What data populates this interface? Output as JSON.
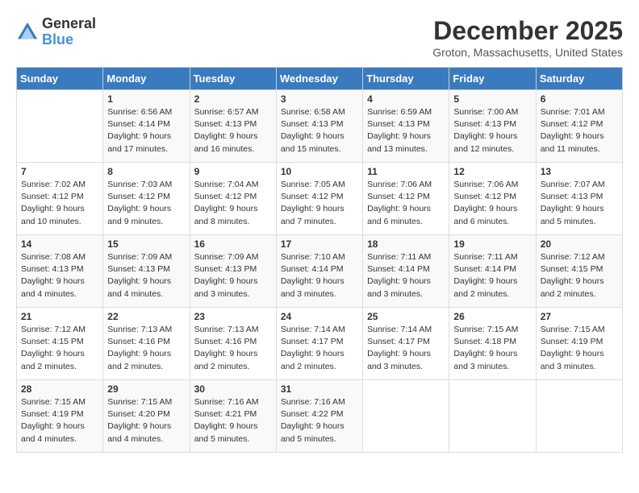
{
  "logo": {
    "text_general": "General",
    "text_blue": "Blue"
  },
  "title": "December 2025",
  "location": "Groton, Massachusetts, United States",
  "weekdays": [
    "Sunday",
    "Monday",
    "Tuesday",
    "Wednesday",
    "Thursday",
    "Friday",
    "Saturday"
  ],
  "weeks": [
    [
      {
        "day": "",
        "sunrise": "",
        "sunset": "",
        "daylight": ""
      },
      {
        "day": "1",
        "sunrise": "Sunrise: 6:56 AM",
        "sunset": "Sunset: 4:14 PM",
        "daylight": "Daylight: 9 hours and 17 minutes."
      },
      {
        "day": "2",
        "sunrise": "Sunrise: 6:57 AM",
        "sunset": "Sunset: 4:13 PM",
        "daylight": "Daylight: 9 hours and 16 minutes."
      },
      {
        "day": "3",
        "sunrise": "Sunrise: 6:58 AM",
        "sunset": "Sunset: 4:13 PM",
        "daylight": "Daylight: 9 hours and 15 minutes."
      },
      {
        "day": "4",
        "sunrise": "Sunrise: 6:59 AM",
        "sunset": "Sunset: 4:13 PM",
        "daylight": "Daylight: 9 hours and 13 minutes."
      },
      {
        "day": "5",
        "sunrise": "Sunrise: 7:00 AM",
        "sunset": "Sunset: 4:13 PM",
        "daylight": "Daylight: 9 hours and 12 minutes."
      },
      {
        "day": "6",
        "sunrise": "Sunrise: 7:01 AM",
        "sunset": "Sunset: 4:12 PM",
        "daylight": "Daylight: 9 hours and 11 minutes."
      }
    ],
    [
      {
        "day": "7",
        "sunrise": "Sunrise: 7:02 AM",
        "sunset": "Sunset: 4:12 PM",
        "daylight": "Daylight: 9 hours and 10 minutes."
      },
      {
        "day": "8",
        "sunrise": "Sunrise: 7:03 AM",
        "sunset": "Sunset: 4:12 PM",
        "daylight": "Daylight: 9 hours and 9 minutes."
      },
      {
        "day": "9",
        "sunrise": "Sunrise: 7:04 AM",
        "sunset": "Sunset: 4:12 PM",
        "daylight": "Daylight: 9 hours and 8 minutes."
      },
      {
        "day": "10",
        "sunrise": "Sunrise: 7:05 AM",
        "sunset": "Sunset: 4:12 PM",
        "daylight": "Daylight: 9 hours and 7 minutes."
      },
      {
        "day": "11",
        "sunrise": "Sunrise: 7:06 AM",
        "sunset": "Sunset: 4:12 PM",
        "daylight": "Daylight: 9 hours and 6 minutes."
      },
      {
        "day": "12",
        "sunrise": "Sunrise: 7:06 AM",
        "sunset": "Sunset: 4:12 PM",
        "daylight": "Daylight: 9 hours and 6 minutes."
      },
      {
        "day": "13",
        "sunrise": "Sunrise: 7:07 AM",
        "sunset": "Sunset: 4:13 PM",
        "daylight": "Daylight: 9 hours and 5 minutes."
      }
    ],
    [
      {
        "day": "14",
        "sunrise": "Sunrise: 7:08 AM",
        "sunset": "Sunset: 4:13 PM",
        "daylight": "Daylight: 9 hours and 4 minutes."
      },
      {
        "day": "15",
        "sunrise": "Sunrise: 7:09 AM",
        "sunset": "Sunset: 4:13 PM",
        "daylight": "Daylight: 9 hours and 4 minutes."
      },
      {
        "day": "16",
        "sunrise": "Sunrise: 7:09 AM",
        "sunset": "Sunset: 4:13 PM",
        "daylight": "Daylight: 9 hours and 3 minutes."
      },
      {
        "day": "17",
        "sunrise": "Sunrise: 7:10 AM",
        "sunset": "Sunset: 4:14 PM",
        "daylight": "Daylight: 9 hours and 3 minutes."
      },
      {
        "day": "18",
        "sunrise": "Sunrise: 7:11 AM",
        "sunset": "Sunset: 4:14 PM",
        "daylight": "Daylight: 9 hours and 3 minutes."
      },
      {
        "day": "19",
        "sunrise": "Sunrise: 7:11 AM",
        "sunset": "Sunset: 4:14 PM",
        "daylight": "Daylight: 9 hours and 2 minutes."
      },
      {
        "day": "20",
        "sunrise": "Sunrise: 7:12 AM",
        "sunset": "Sunset: 4:15 PM",
        "daylight": "Daylight: 9 hours and 2 minutes."
      }
    ],
    [
      {
        "day": "21",
        "sunrise": "Sunrise: 7:12 AM",
        "sunset": "Sunset: 4:15 PM",
        "daylight": "Daylight: 9 hours and 2 minutes."
      },
      {
        "day": "22",
        "sunrise": "Sunrise: 7:13 AM",
        "sunset": "Sunset: 4:16 PM",
        "daylight": "Daylight: 9 hours and 2 minutes."
      },
      {
        "day": "23",
        "sunrise": "Sunrise: 7:13 AM",
        "sunset": "Sunset: 4:16 PM",
        "daylight": "Daylight: 9 hours and 2 minutes."
      },
      {
        "day": "24",
        "sunrise": "Sunrise: 7:14 AM",
        "sunset": "Sunset: 4:17 PM",
        "daylight": "Daylight: 9 hours and 2 minutes."
      },
      {
        "day": "25",
        "sunrise": "Sunrise: 7:14 AM",
        "sunset": "Sunset: 4:17 PM",
        "daylight": "Daylight: 9 hours and 3 minutes."
      },
      {
        "day": "26",
        "sunrise": "Sunrise: 7:15 AM",
        "sunset": "Sunset: 4:18 PM",
        "daylight": "Daylight: 9 hours and 3 minutes."
      },
      {
        "day": "27",
        "sunrise": "Sunrise: 7:15 AM",
        "sunset": "Sunset: 4:19 PM",
        "daylight": "Daylight: 9 hours and 3 minutes."
      }
    ],
    [
      {
        "day": "28",
        "sunrise": "Sunrise: 7:15 AM",
        "sunset": "Sunset: 4:19 PM",
        "daylight": "Daylight: 9 hours and 4 minutes."
      },
      {
        "day": "29",
        "sunrise": "Sunrise: 7:15 AM",
        "sunset": "Sunset: 4:20 PM",
        "daylight": "Daylight: 9 hours and 4 minutes."
      },
      {
        "day": "30",
        "sunrise": "Sunrise: 7:16 AM",
        "sunset": "Sunset: 4:21 PM",
        "daylight": "Daylight: 9 hours and 5 minutes."
      },
      {
        "day": "31",
        "sunrise": "Sunrise: 7:16 AM",
        "sunset": "Sunset: 4:22 PM",
        "daylight": "Daylight: 9 hours and 5 minutes."
      },
      {
        "day": "",
        "sunrise": "",
        "sunset": "",
        "daylight": ""
      },
      {
        "day": "",
        "sunrise": "",
        "sunset": "",
        "daylight": ""
      },
      {
        "day": "",
        "sunrise": "",
        "sunset": "",
        "daylight": ""
      }
    ]
  ]
}
